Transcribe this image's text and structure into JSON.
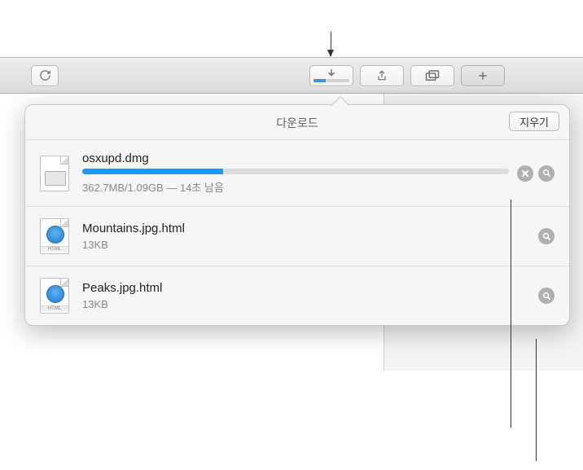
{
  "popover": {
    "title": "다운로드",
    "clear_button": "지우기"
  },
  "downloads": [
    {
      "name": "osxupd.dmg",
      "status": "362.7MB/1.09GB — 14초 남음",
      "progress_percent": 33,
      "type": "dmg",
      "in_progress": true
    },
    {
      "name": "Mountains.jpg.html",
      "status": "13KB",
      "type": "html",
      "in_progress": false
    },
    {
      "name": "Peaks.jpg.html",
      "status": "13KB",
      "type": "html",
      "in_progress": false
    }
  ],
  "icon_labels": {
    "html": "HTML"
  },
  "toolbar": {
    "download_progress_percent": 33
  }
}
